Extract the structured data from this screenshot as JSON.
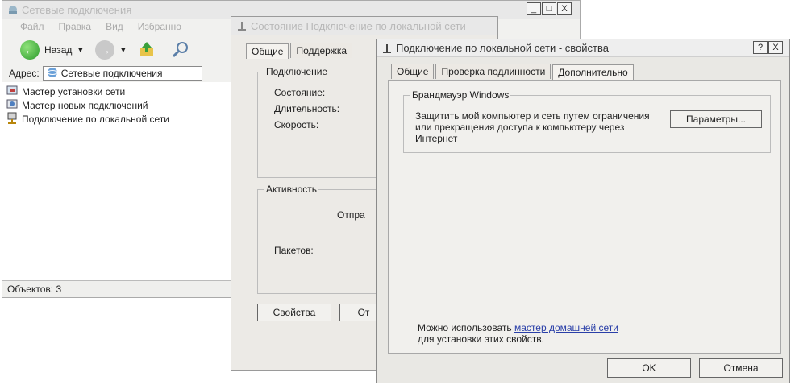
{
  "explorer": {
    "title": "Сетевые подключения",
    "menu": [
      "Файл",
      "Правка",
      "Вид",
      "Избранно"
    ],
    "toolbar": {
      "back_label": "Назад"
    },
    "address": {
      "label": "Адрес:",
      "value": "Сетевые подключения"
    },
    "items": [
      {
        "label": "Мастер установки сети",
        "icon": "network-setup-wizard-icon"
      },
      {
        "label": "Мастер новых подключений",
        "icon": "new-connection-wizard-icon"
      },
      {
        "label": "Подключение по локальной сети",
        "icon": "lan-connection-icon"
      }
    ],
    "status": "Объектов: 3"
  },
  "status_window": {
    "title": "Состояние Подключение по локальной сети",
    "tabs": [
      "Общие",
      "Поддержка"
    ],
    "connection_group": "Подключение",
    "state_label": "Состояние:",
    "duration_label": "Длительность:",
    "speed_label": "Скорость:",
    "activity_group": "Активность",
    "sent_label": "Отпра",
    "packets_label": "Пакетов:",
    "properties_button": "Свойства",
    "second_button": "От"
  },
  "props_window": {
    "title": "Подключение по локальной сети - свойства",
    "help_button": "?",
    "close_button": "X",
    "tabs": [
      "Общие",
      "Проверка подлинности",
      "Дополнительно"
    ],
    "selected_tab": 2,
    "firewall_group": "Брандмауэр Windows",
    "firewall_text": "Защитить мой компьютер и сеть путем ограничения или прекращения доступа к компьютеру через Интернет",
    "params_button": "Параметры...",
    "footer_text_before": "Можно использовать",
    "footer_link": "мастер домашней сети",
    "footer_text_after": "для установки этих свойств.",
    "ok_button": "OK",
    "cancel_button": "Отмена"
  },
  "colors": {
    "link": "#2a3fa8",
    "dialog_bg": "#e9e8e4"
  }
}
